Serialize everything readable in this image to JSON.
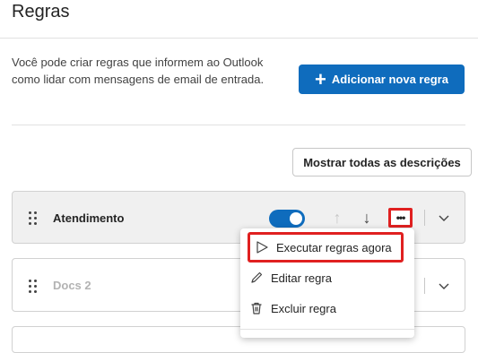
{
  "page": {
    "title": "Regras"
  },
  "intro": {
    "description": "Você pode criar regras que informem ao Outlook como lidar com mensagens de email de entrada.",
    "add_button_label": "Adicionar nova regra"
  },
  "toolbar": {
    "show_descriptions_label": "Mostrar todas as descrições"
  },
  "rules": [
    {
      "name": "Atendimento",
      "enabled": true
    },
    {
      "name": "Docs 2",
      "enabled": false
    }
  ],
  "context_menu": {
    "items": [
      {
        "label": "Executar regras agora",
        "icon": "play-icon"
      },
      {
        "label": "Editar regra",
        "icon": "pencil-icon"
      },
      {
        "label": "Excluir regra",
        "icon": "trash-icon"
      }
    ]
  },
  "colors": {
    "accent": "#0f6cbd",
    "highlight": "#e02020"
  }
}
